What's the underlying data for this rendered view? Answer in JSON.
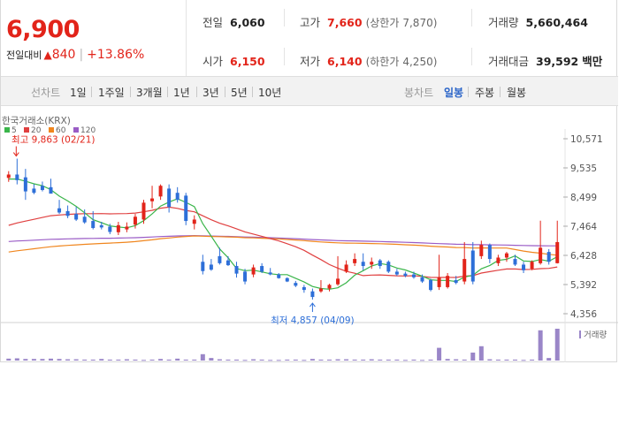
{
  "quote": {
    "price": "6,900",
    "change_label": "전일대비",
    "change_value": "840",
    "change_pct": "+13.86%",
    "prev_close_label": "전일",
    "prev_close": "6,060",
    "high_label": "고가",
    "high": "7,660",
    "upper_limit_label": "(상한가",
    "upper_limit": "7,870)",
    "volume_label": "거래량",
    "volume": "5,660,464",
    "open_label": "시가",
    "open": "6,150",
    "low_label": "저가",
    "low": "6,140",
    "lower_limit_label": "(하한가",
    "lower_limit": "4,250)",
    "amount_label": "거래대금",
    "amount": "39,592",
    "amount_unit": "백만"
  },
  "toolbar": {
    "line_chart_title": "선차트",
    "ranges": [
      "1일",
      "1주일",
      "3개월",
      "1년",
      "3년",
      "5년",
      "10년"
    ],
    "candle_chart_title": "봉차트",
    "periods": [
      "일봉",
      "주봉",
      "월봉"
    ],
    "active_period": "일봉"
  },
  "colors": {
    "up": "#e2241a",
    "down": "#2e6fd8",
    "ma5": "#3ab54a",
    "ma20": "#e04040",
    "ma60": "#f0861e",
    "ma120": "#9a5cc6",
    "volume": "#9a86c8"
  },
  "chart_data": {
    "type": "candlestick",
    "source_label": "한국거래소(KRX)",
    "y_ticks": [
      10571,
      9535,
      8499,
      7464,
      6428,
      5392,
      4356
    ],
    "y_tick_labels": [
      "10,571",
      "9,535",
      "8,499",
      "7,464",
      "6,428",
      "5,392",
      "4,356"
    ],
    "ylim": [
      4356,
      10571
    ],
    "legend": [
      "5",
      "20",
      "60",
      "120"
    ],
    "high_annotation": "최고 9,863 (02/21)",
    "low_annotation": "최저 4,857 (04/09)",
    "volume_label": "거래량",
    "candles": [
      [
        9180,
        9420,
        9040,
        9300
      ],
      [
        9300,
        9863,
        8950,
        9100
      ],
      [
        9200,
        9500,
        8400,
        8700
      ],
      [
        8800,
        8960,
        8600,
        8650
      ],
      [
        8900,
        9050,
        8700,
        8750
      ],
      [
        8850,
        9150,
        8780,
        8620
      ],
      [
        8100,
        8400,
        7900,
        7950
      ],
      [
        8000,
        8200,
        7750,
        7830
      ],
      [
        7900,
        8150,
        7650,
        7700
      ],
      [
        7800,
        8060,
        7550,
        7600
      ],
      [
        7650,
        8000,
        7350,
        7400
      ],
      [
        7500,
        7620,
        7350,
        7420
      ],
      [
        7450,
        7550,
        7180,
        7260
      ],
      [
        7250,
        7620,
        7150,
        7500
      ],
      [
        7350,
        7600,
        7250,
        7450
      ],
      [
        7520,
        7900,
        7380,
        7800
      ],
      [
        7700,
        8400,
        7550,
        8300
      ],
      [
        8350,
        8900,
        8100,
        8450
      ],
      [
        8520,
        8950,
        8400,
        8900
      ],
      [
        8800,
        8950,
        7950,
        8150
      ],
      [
        8650,
        8850,
        8300,
        8400
      ],
      [
        8550,
        8650,
        7500,
        7650
      ],
      [
        7550,
        7850,
        7350,
        7700
      ],
      [
        6200,
        6450,
        5750,
        5870
      ],
      [
        6100,
        6300,
        5880,
        5920
      ],
      [
        6400,
        6700,
        6100,
        6150
      ],
      [
        6250,
        6400,
        6050,
        6080
      ],
      [
        6050,
        6200,
        5640,
        5780
      ],
      [
        5850,
        5950,
        5400,
        5500
      ],
      [
        5750,
        6100,
        5650,
        6000
      ],
      [
        6050,
        6150,
        5800,
        5850
      ],
      [
        5820,
        5980,
        5720,
        5750
      ],
      [
        5750,
        5800,
        5600,
        5620
      ],
      [
        5620,
        5650,
        5480,
        5500
      ],
      [
        5450,
        5520,
        5300,
        5350
      ],
      [
        5300,
        5380,
        5100,
        5200
      ],
      [
        5150,
        5250,
        4857,
        4950
      ],
      [
        5150,
        5550,
        5100,
        5250
      ],
      [
        5250,
        5420,
        5150,
        5380
      ],
      [
        5400,
        6400,
        5350,
        5600
      ],
      [
        5850,
        6250,
        5800,
        6100
      ],
      [
        6150,
        6500,
        6050,
        6300
      ],
      [
        6200,
        6500,
        5900,
        6050
      ],
      [
        6100,
        6350,
        5950,
        6200
      ],
      [
        6250,
        6300,
        5950,
        6050
      ],
      [
        6200,
        6250,
        5800,
        5850
      ],
      [
        5850,
        5950,
        5700,
        5750
      ],
      [
        5780,
        5850,
        5650,
        5700
      ],
      [
        5750,
        5850,
        5600,
        5650
      ],
      [
        5650,
        5750,
        5450,
        5500
      ],
      [
        5550,
        5600,
        5150,
        5200
      ],
      [
        5300,
        6450,
        5200,
        5650
      ],
      [
        5300,
        5800,
        5250,
        5700
      ],
      [
        5550,
        5700,
        5400,
        5450
      ],
      [
        5500,
        6900,
        5400,
        6300
      ],
      [
        6600,
        6900,
        5400,
        5500
      ],
      [
        6400,
        6950,
        6300,
        6800
      ],
      [
        6800,
        6850,
        6150,
        6300
      ],
      [
        6150,
        6450,
        6050,
        6350
      ],
      [
        6350,
        6550,
        6200,
        6500
      ],
      [
        6300,
        6450,
        6050,
        6100
      ],
      [
        6100,
        6200,
        5800,
        5900
      ],
      [
        5950,
        6250,
        5900,
        6200
      ],
      [
        6150,
        7660,
        6100,
        6700
      ],
      [
        6550,
        6650,
        6100,
        6200
      ],
      [
        6150,
        7660,
        6140,
        6900
      ]
    ],
    "volume": [
      0.06,
      0.07,
      0.05,
      0.05,
      0.05,
      0.06,
      0.05,
      0.04,
      0.04,
      0.03,
      0.03,
      0.05,
      0.03,
      0.03,
      0.04,
      0.03,
      0.02,
      0.03,
      0.05,
      0.03,
      0.06,
      0.03,
      0.03,
      0.2,
      0.08,
      0.04,
      0.03,
      0.03,
      0.02,
      0.04,
      0.03,
      0.02,
      0.02,
      0.03,
      0.03,
      0.02,
      0.05,
      0.03,
      0.03,
      0.04,
      0.04,
      0.03,
      0.03,
      0.04,
      0.03,
      0.03,
      0.03,
      0.02,
      0.03,
      0.02,
      0.03,
      0.4,
      0.05,
      0.04,
      0.03,
      0.25,
      0.45,
      0.04,
      0.03,
      0.03,
      0.03,
      0.02,
      0.03,
      0.95,
      0.08,
      1.0
    ]
  }
}
